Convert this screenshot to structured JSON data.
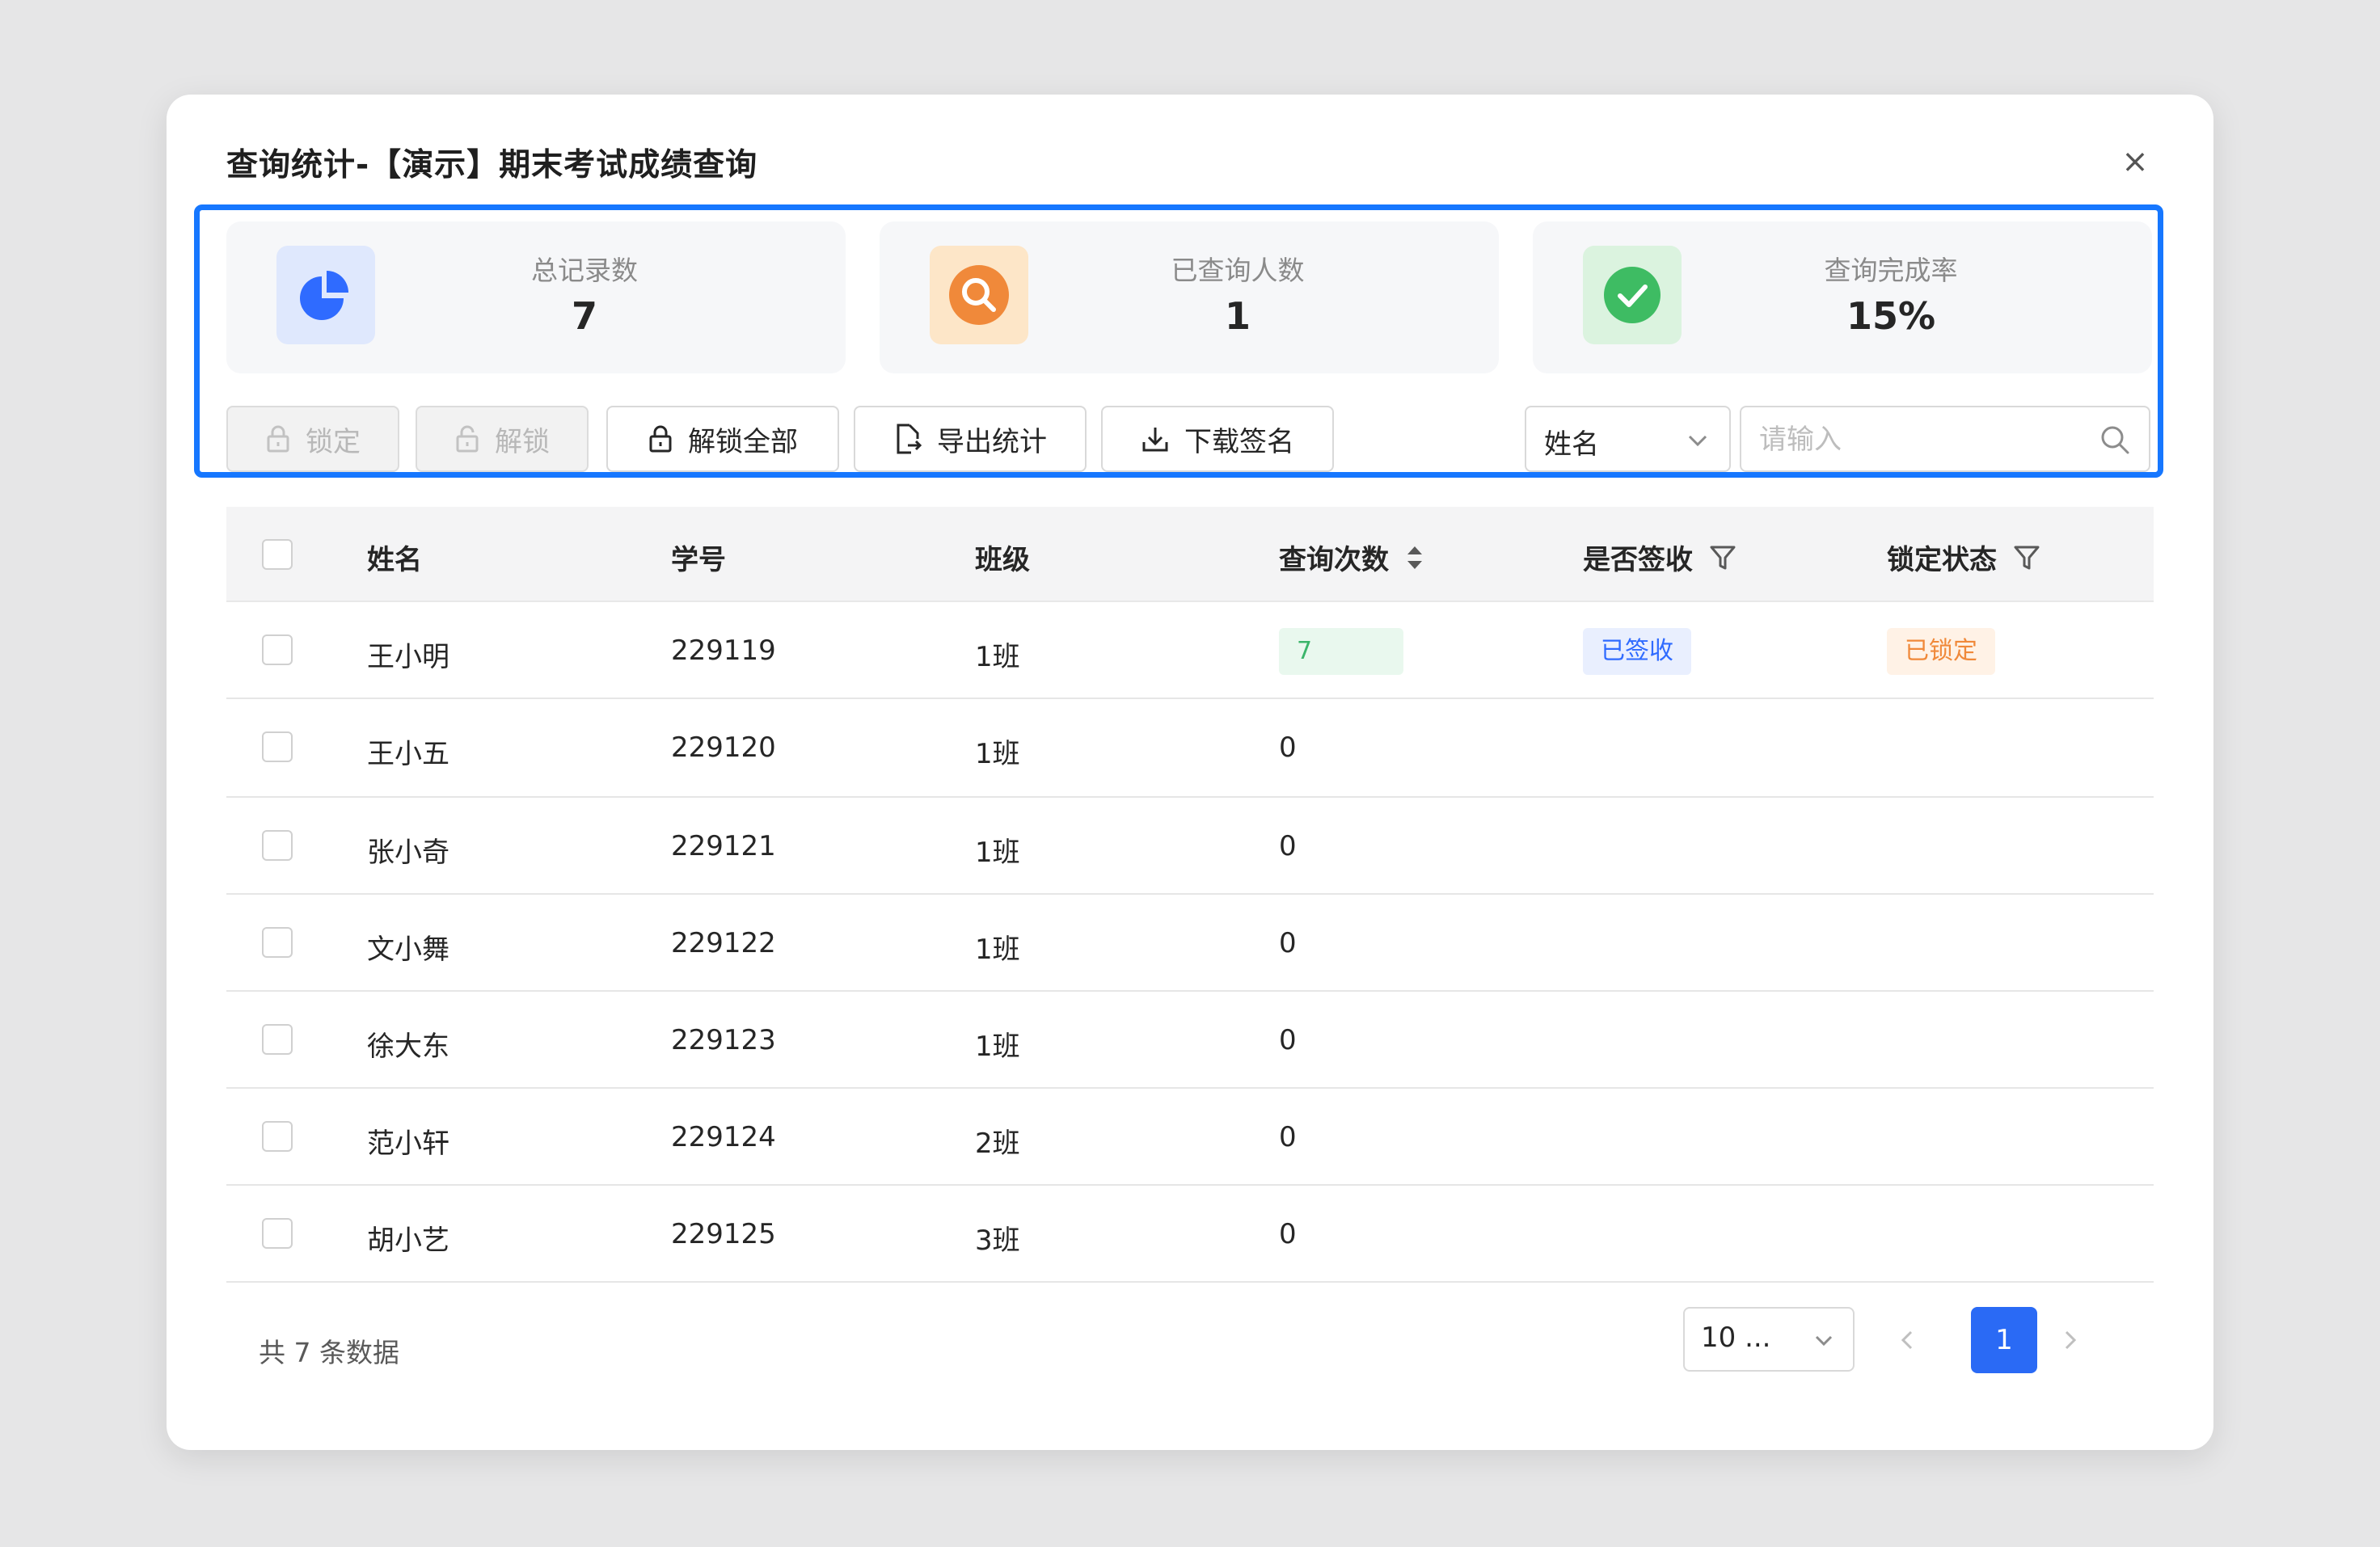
{
  "dialog": {
    "title": "查询统计-【演示】期末考试成绩查询",
    "close_glyph": "×"
  },
  "stats": [
    {
      "label": "总记录数",
      "value": "7",
      "icon": "pie-chart-icon",
      "icon_bg": "#dfe8fd",
      "icon_color": "#2f6bff"
    },
    {
      "label": "已查询人数",
      "value": "1",
      "icon": "search-icon",
      "icon_bg": "#fde6c8",
      "icon_color": "#f0893a"
    },
    {
      "label": "查询完成率",
      "value": "15%",
      "icon": "check-circle-icon",
      "icon_bg": "#dbf3df",
      "icon_color": "#3ebc63"
    }
  ],
  "toolbar": {
    "lock_label": "锁定",
    "unlock_label": "解锁",
    "unlock_all_label": "解锁全部",
    "export_label": "导出统计",
    "download_label": "下载签名",
    "field_select_value": "姓名",
    "search_placeholder": "请输入"
  },
  "table": {
    "headers": {
      "name": "姓名",
      "student_id": "学号",
      "class": "班级",
      "query_count": "查询次数",
      "signed": "是否签收",
      "lock_status": "锁定状态"
    },
    "rows": [
      {
        "name": "王小明",
        "student_id": "229119",
        "class": "1班",
        "query_count": "7",
        "signed": "已签收",
        "lock_status": "已锁定"
      },
      {
        "name": "王小五",
        "student_id": "229120",
        "class": "1班",
        "query_count": "0",
        "signed": "",
        "lock_status": ""
      },
      {
        "name": "张小奇",
        "student_id": "229121",
        "class": "1班",
        "query_count": "0",
        "signed": "",
        "lock_status": ""
      },
      {
        "name": "文小舞",
        "student_id": "229122",
        "class": "1班",
        "query_count": "0",
        "signed": "",
        "lock_status": ""
      },
      {
        "name": "徐大东",
        "student_id": "229123",
        "class": "1班",
        "query_count": "0",
        "signed": "",
        "lock_status": ""
      },
      {
        "name": "范小轩",
        "student_id": "229124",
        "class": "2班",
        "query_count": "0",
        "signed": "",
        "lock_status": ""
      },
      {
        "name": "胡小艺",
        "student_id": "229125",
        "class": "3班",
        "query_count": "0",
        "signed": "",
        "lock_status": ""
      }
    ]
  },
  "footer": {
    "total_text": "共 7 条数据",
    "page_size_label": "10 ...",
    "current_page": "1"
  },
  "colors": {
    "accent": "#1677ff",
    "primary_page": "#2a6af5"
  }
}
